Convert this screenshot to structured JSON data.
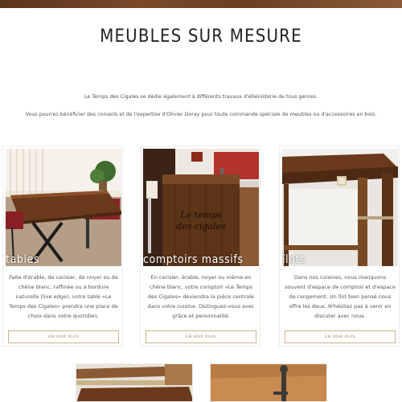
{
  "page": {
    "title": "MEUBLES SUR MESURE",
    "intro_1": "Le Temps des Cigales se dédie également à différents travaux d'ébénisterie de tous genres.",
    "intro_2": "Vous pourrez bénéficier des conseils et de l'expertise d'Olivier Doray pour toute commande spéciale de meubles ou d'accessoires en bois."
  },
  "cards": [
    {
      "overlay": "tables",
      "desc": "Faite d'érable, de cerisier, de noyer ou de chêne blanc, raffinée ou à bordure naturelle (live edge), votre table «Le Temps des Cigales» prendra une place de choix dans votre quotidien.",
      "button": "EN VOIR PLUS"
    },
    {
      "overlay": "comptoirs massifs",
      "desc": "En cerisier, érable, noyer ou même en chêne blanc, votre comptoir «Le Temps des Cigales» deviendra la pièce centrale dans votre cuisine. Distinguez-vous avec grâce et personnalité.",
      "button": "EN VOIR PLUS",
      "photo_logo": "Le temps des cigales"
    },
    {
      "overlay": "îlots",
      "desc": "Dans nos cuisines, nous manquons souvent d'espace de comptoir et d'espace de rangement. Un îlot bien pensé nous offre les deux. N'hésitez pas à venir en discuter avec nous.",
      "button": "EN VOIR PLUS"
    }
  ],
  "colors": {
    "top_bar": "#6a3e22",
    "button_border": "#c9b48a",
    "button_text": "#9a8560"
  }
}
